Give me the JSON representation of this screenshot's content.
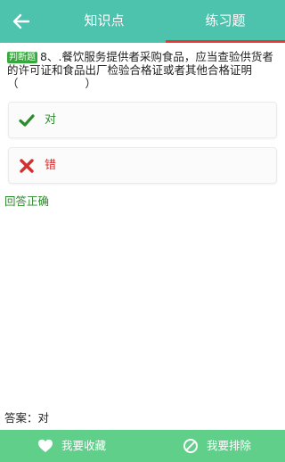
{
  "header": {
    "back_icon": "arrow-left-icon",
    "tabs": [
      {
        "label": "知识点"
      },
      {
        "label": "练习题"
      }
    ],
    "accent": "#4dc2ad",
    "active_underline": "#e53935"
  },
  "question": {
    "type_badge": "判断题",
    "text": "8、.餐饮服务提供者采购食品，应当查验供货者的许可证和食品出厂检验合格证或者其他合格证明（　　　　　　）"
  },
  "options": [
    {
      "icon": "check-icon",
      "label": "对",
      "color": "#2e8b2e"
    },
    {
      "icon": "cross-icon",
      "label": "错",
      "color": "#d32f2f"
    }
  ],
  "result_text": "回答正确",
  "answer_text": "答案：对",
  "bottom_bar": {
    "favorite": {
      "icon": "heart-icon",
      "label": "我要收藏"
    },
    "exclude": {
      "icon": "ban-icon",
      "label": "我要排除"
    },
    "color": "#5fcf8a"
  }
}
